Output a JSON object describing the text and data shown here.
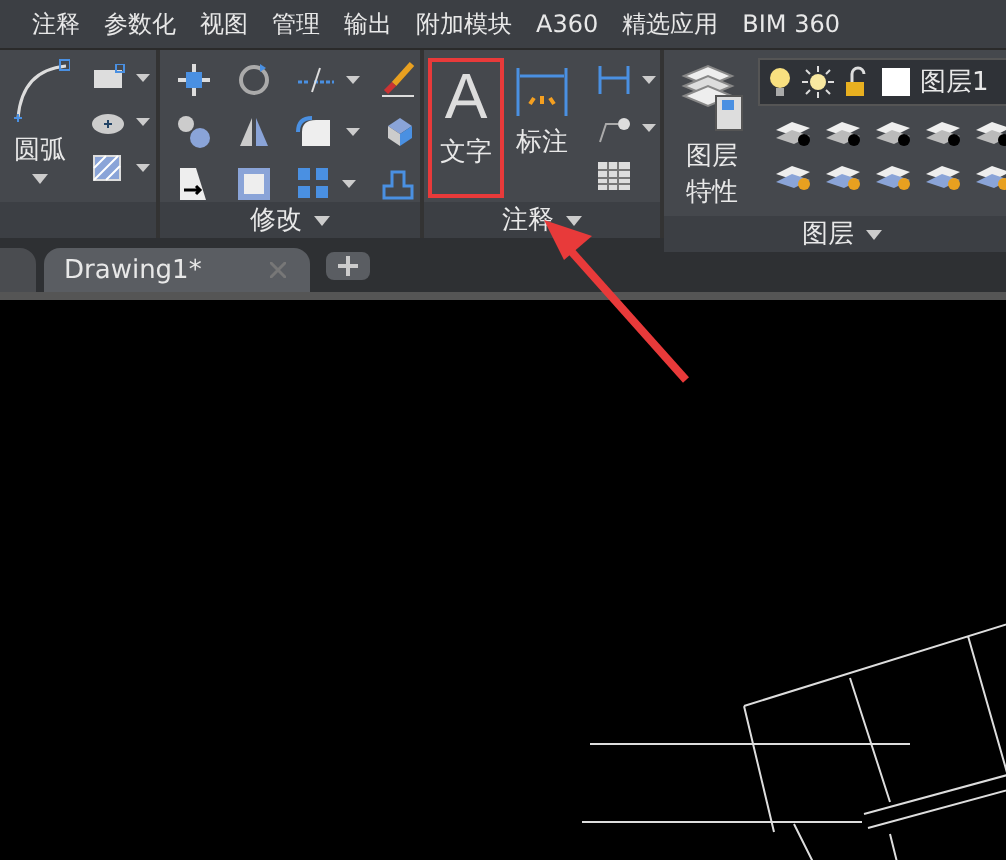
{
  "menu_tabs": [
    {
      "label": "注释",
      "selected": false
    },
    {
      "label": "参数化",
      "selected": false
    },
    {
      "label": "视图",
      "selected": false
    },
    {
      "label": "管理",
      "selected": false
    },
    {
      "label": "输出",
      "selected": false
    },
    {
      "label": "附加模块",
      "selected": false
    },
    {
      "label": "A360",
      "selected": false
    },
    {
      "label": "精选应用",
      "selected": false
    },
    {
      "label": "BIM 360",
      "selected": false
    }
  ],
  "draw_panel": {
    "arc_label": "圆弧"
  },
  "modify_panel": {
    "title": "修改"
  },
  "annotation_panel": {
    "title": "注释",
    "text_icon": "A",
    "text_button": "文字",
    "dimension_button": "标注"
  },
  "layers_panel": {
    "title": "图层",
    "properties_button": "图层特性",
    "current_layer": "图层1"
  },
  "file_tabs": [
    {
      "label": "Drawing1*",
      "selected": true
    }
  ]
}
